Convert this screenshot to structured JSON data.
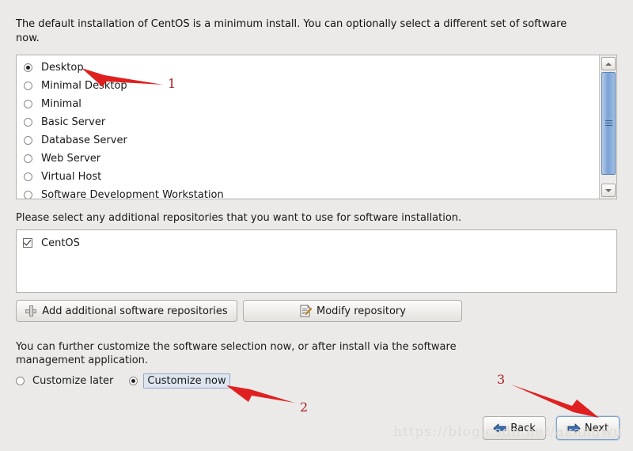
{
  "intro": {
    "text": "The default installation of CentOS is a minimum install. You can optionally select a different set of software now."
  },
  "software_groups": {
    "selected": "Desktop",
    "items": [
      {
        "label": "Desktop",
        "selected": true
      },
      {
        "label": "Minimal Desktop",
        "selected": false
      },
      {
        "label": "Minimal",
        "selected": false
      },
      {
        "label": "Basic Server",
        "selected": false
      },
      {
        "label": "Database Server",
        "selected": false
      },
      {
        "label": "Web Server",
        "selected": false
      },
      {
        "label": "Virtual Host",
        "selected": false
      },
      {
        "label": "Software Development Workstation",
        "selected": false
      }
    ],
    "scrollbar": {
      "up_icon": "chevron-up-icon",
      "down_icon": "chevron-down-icon"
    }
  },
  "repositories": {
    "label": "Please select any additional repositories that you want to use for software installation.",
    "items": [
      {
        "label": "CentOS",
        "checked": true
      }
    ],
    "add_button": {
      "label": "Add additional software repositories",
      "icon": "plus-icon"
    },
    "modify_button": {
      "label": "Modify repository",
      "icon": "document-pencil-icon"
    }
  },
  "customize": {
    "text": "You can further customize the software selection now, or after install via the software management application.",
    "options": [
      {
        "label": "Customize later",
        "selected": false,
        "focused": false
      },
      {
        "label": "Customize now",
        "selected": true,
        "focused": true
      }
    ]
  },
  "navigation": {
    "back": {
      "label": "Back",
      "icon": "arrow-left-icon"
    },
    "next": {
      "label": "Next",
      "icon": "arrow-right-icon",
      "focused": true
    }
  },
  "watermark": {
    "text": "https://blog.csdn.net/akangwu"
  },
  "annotations": {
    "items": [
      {
        "number": "1",
        "target": "Desktop radio option"
      },
      {
        "number": "2",
        "target": "Customize now radio option"
      },
      {
        "number": "3",
        "target": "Next button"
      }
    ],
    "color": "#e02020",
    "number_color": "#a81f1f"
  },
  "colors": {
    "background": "#ebeae8",
    "field_background": "#ffffff",
    "border": "#b4b1ab",
    "scroll_thumb": "#7ba2d6",
    "focus_border": "#7ea0c8",
    "arrow_blue": "#3a6fb5"
  }
}
